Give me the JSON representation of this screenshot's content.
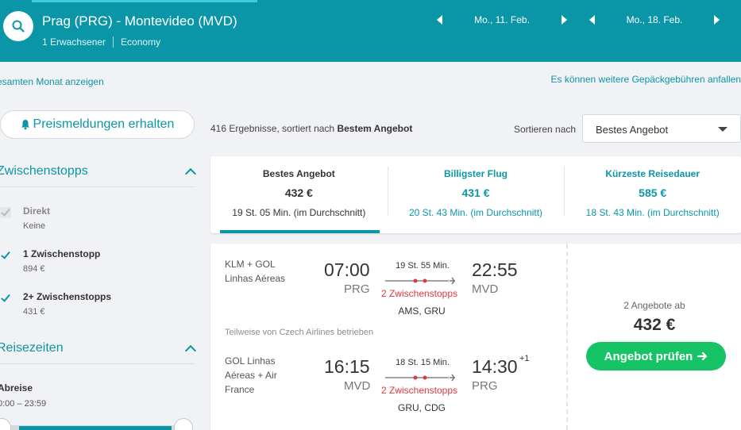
{
  "header": {
    "route": "Prag (PRG) - Montevideo (MVD)",
    "passengers": "1 Erwachsener",
    "cabin": "Economy",
    "outbound_date": "Mo., 11. Feb.",
    "return_date": "Mo., 18. Feb."
  },
  "links": {
    "month": "esamten Monat anzeigen",
    "baggage": "Es können weitere Gepäckgebühren anfallen"
  },
  "sidebar": {
    "alert_button": "Preismeldungen erhalten",
    "stops_title": "Zwischenstopps",
    "stops": [
      {
        "label": "Direkt",
        "sub": "Keine"
      },
      {
        "label": "1 Zwischenstopp",
        "sub": "894 €"
      },
      {
        "label": "2+ Zwischenstopps",
        "sub": "431 €"
      }
    ],
    "times_title": "Reisezeiten",
    "departure_label": "Abreise",
    "departure_range": "0:00 – 23:59"
  },
  "results": {
    "count_prefix": "416 Ergebnisse, sortiert nach",
    "count_sort": "Bestem Angebot",
    "sort_label": "Sortieren nach",
    "sort_value": "Bestes Angebot"
  },
  "tabs": [
    {
      "title": "Bestes Angebot",
      "price": "432 €",
      "duration": "19 St. 05 Min. (im Durchschnitt)"
    },
    {
      "title": "Billigster Flug",
      "price": "431 €",
      "duration": "20 St. 43 Min. (im Durchschnitt)"
    },
    {
      "title": "Kürzeste Reisedauer",
      "price": "585 €",
      "duration": "18 St. 43 Min. (im Durchschnitt)"
    }
  ],
  "result": {
    "outbound": {
      "airline": "KLM + GOL Linhas Aéreas",
      "dep_time": "07:00",
      "dep_code": "PRG",
      "duration": "19 St. 55 Min.",
      "stops": "2 Zwischenstopps",
      "via": "AMS, GRU",
      "arr_time": "22:55",
      "arr_code": "MVD"
    },
    "operated_by": "Teilweise von Czech Airlines betrieben",
    "inbound": {
      "airline": "GOL Linhas Aéreas + Air France",
      "dep_time": "16:15",
      "dep_code": "MVD",
      "duration": "18 St. 15 Min.",
      "stops": "2 Zwischenstopps",
      "via": "GRU, CDG",
      "arr_time": "14:30",
      "arr_plus": "+1",
      "arr_code": "PRG"
    },
    "offers": "2 Angebote ab",
    "price": "432 €",
    "cta": "Angebot prüfen"
  }
}
